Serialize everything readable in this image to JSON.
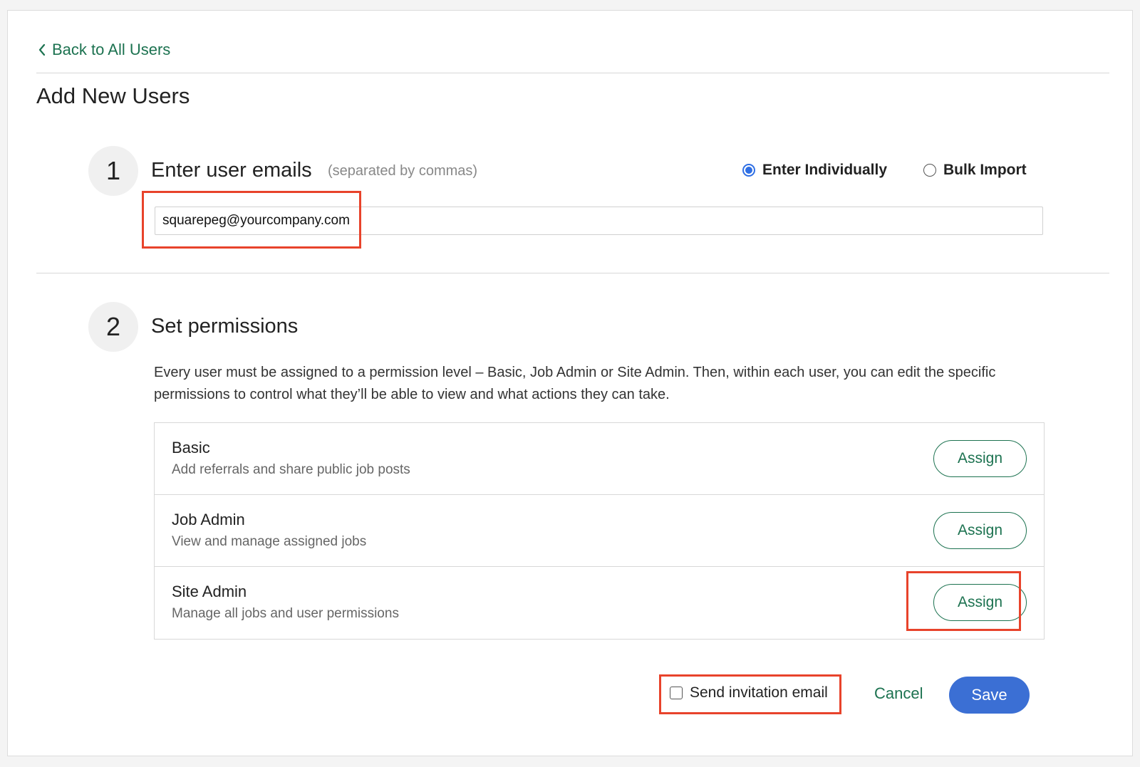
{
  "nav": {
    "back_label": "Back to All Users"
  },
  "page": {
    "title": "Add New Users"
  },
  "step1": {
    "number": "1",
    "title": "Enter user emails",
    "hint": "(separated by commas)",
    "mode_options": [
      {
        "label": "Enter Individually",
        "selected": true
      },
      {
        "label": "Bulk Import",
        "selected": false
      }
    ],
    "email_value": "squarepeg@yourcompany.com"
  },
  "step2": {
    "number": "2",
    "title": "Set permissions",
    "description": "Every user must be assigned to a permission level – Basic, Job Admin or Site Admin. Then, within each user, you can edit the specific permissions to control what they’ll be able to view and what actions they can take.",
    "levels": [
      {
        "name": "Basic",
        "description": "Add referrals and share public job posts",
        "button": "Assign"
      },
      {
        "name": "Job Admin",
        "description": "View and manage assigned jobs",
        "button": "Assign"
      },
      {
        "name": "Site Admin",
        "description": "Manage all jobs and user permissions",
        "button": "Assign"
      }
    ]
  },
  "footer": {
    "send_invitation_label": "Send invitation email",
    "send_invitation_checked": false,
    "cancel_label": "Cancel",
    "save_label": "Save"
  },
  "colors": {
    "accent_green": "#1c7250",
    "primary_blue": "#3b6fd4",
    "highlight_red": "#e8432b"
  },
  "icons": {
    "back": "chevron-left-icon"
  }
}
